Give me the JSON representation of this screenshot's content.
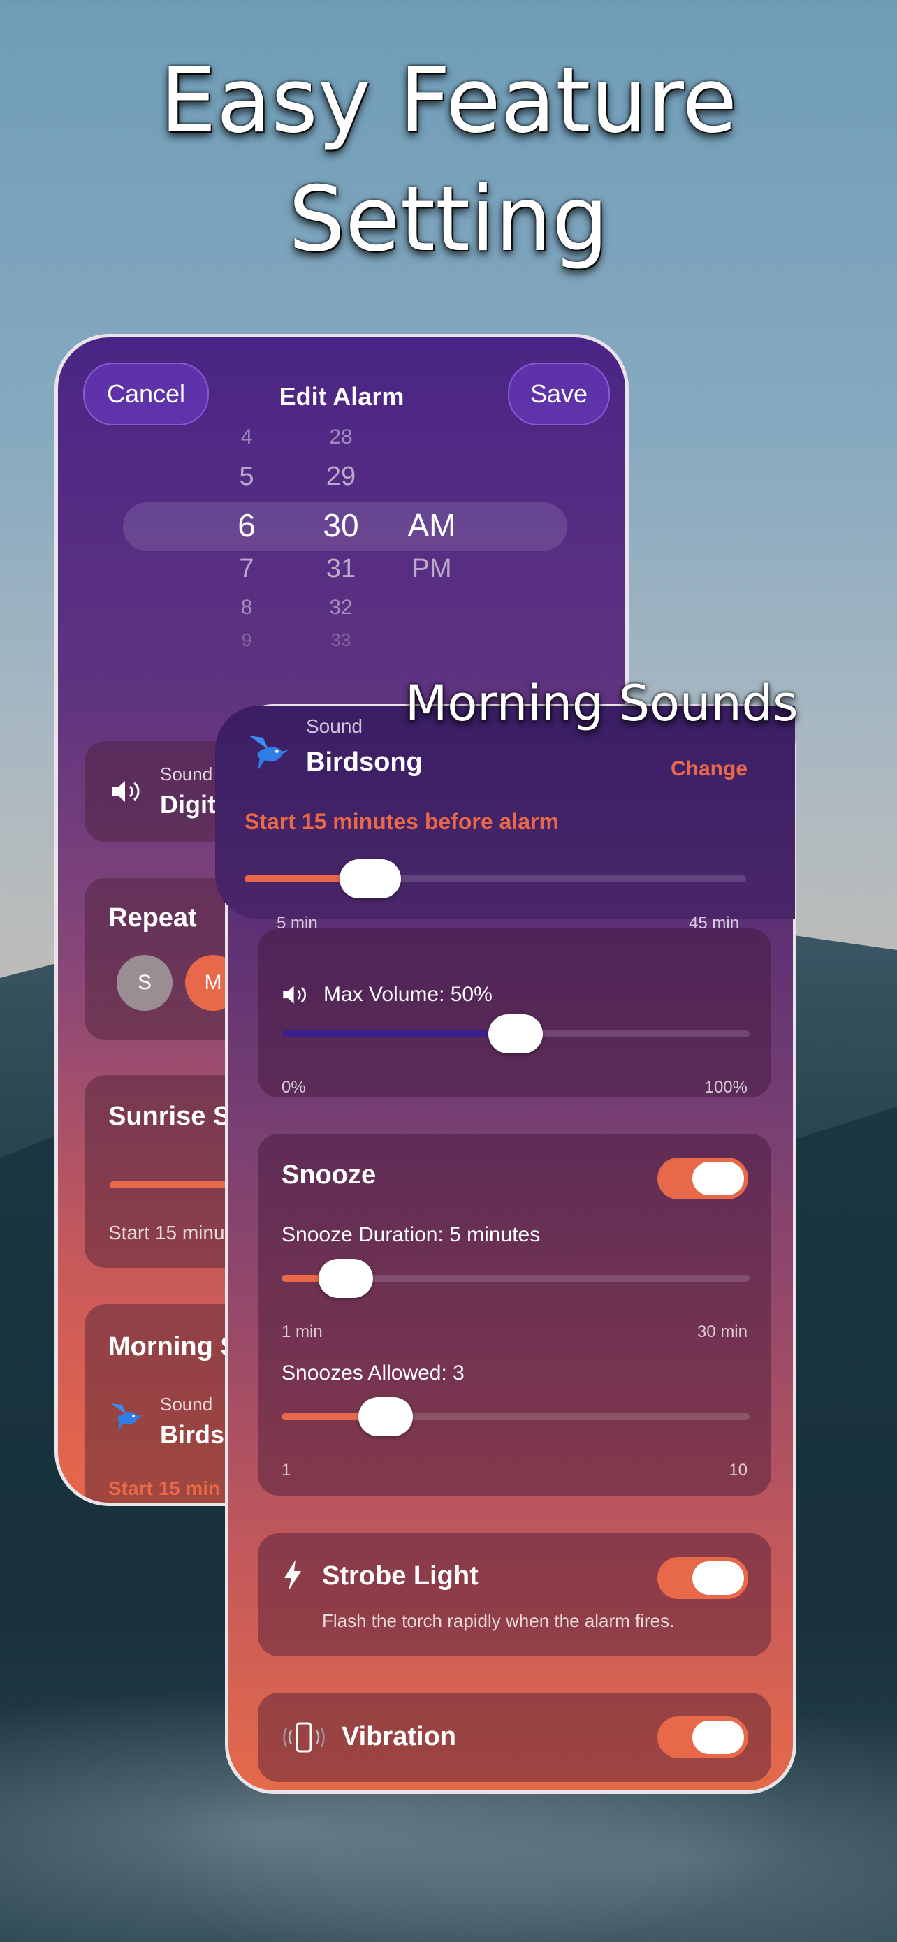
{
  "headline": {
    "line1": "Easy Feature",
    "line2": "Setting"
  },
  "back_phone": {
    "cancel_label": "Cancel",
    "title": "Edit Alarm",
    "save_label": "Save",
    "picker": {
      "hours": [
        "4",
        "5",
        "6",
        "7",
        "8",
        "9"
      ],
      "minutes": [
        "28",
        "29",
        "30",
        "31",
        "32",
        "33"
      ],
      "period": [
        "AM",
        "PM"
      ]
    },
    "sound_card": {
      "caption": "Sound",
      "value": "Digita"
    },
    "repeat_card": {
      "title": "Repeat",
      "days": [
        "S",
        "M"
      ]
    },
    "sunrise_card": {
      "title": "Sunrise S",
      "subtitle": "Start 15 minu"
    },
    "morning_card": {
      "title": "Morning S",
      "caption": "Sound",
      "value": "Birdsc",
      "subtitle": "Start 15 min"
    }
  },
  "callout": "Morning Sounds",
  "front_phone": {
    "sound": {
      "caption": "Sound",
      "value": "Birdsong",
      "change_label": "Change"
    },
    "start_label": "Start 15 minutes before alarm",
    "start_slider": {
      "value": 15,
      "min_label": "5 min",
      "max_label": "45 min"
    },
    "volume": {
      "label": "Max Volume: 50%",
      "value": 50,
      "min_label": "0%",
      "max_label": "100%"
    },
    "snooze": {
      "title": "Snooze",
      "enabled": true,
      "duration_label": "Snooze Duration: 5 minutes",
      "duration_value": 5,
      "duration_min": "1 min",
      "duration_max": "30 min",
      "allowed_label": "Snoozes Allowed: 3",
      "allowed_value": 3,
      "allowed_min": "1",
      "allowed_max": "10"
    },
    "strobe": {
      "title": "Strobe Light",
      "enabled": true,
      "description": "Flash the torch rapidly when the alarm fires."
    },
    "vibration": {
      "title": "Vibration",
      "enabled": true
    }
  },
  "colors": {
    "accent": "#e8694a",
    "volume_fill": "#3b1f8c"
  },
  "icons": [
    "speaker-icon",
    "hummingbird-icon",
    "bolt-icon",
    "phone-vibrate-icon"
  ]
}
